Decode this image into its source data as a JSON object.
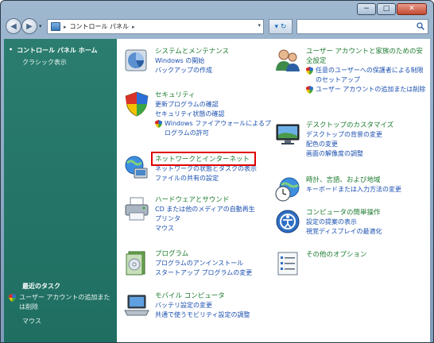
{
  "window": {
    "caption_minimize": "−",
    "caption_maximize": "□",
    "caption_close": "✕"
  },
  "nav": {
    "back_glyph": "◀",
    "forward_glyph": "▶",
    "recent_glyph": "▾",
    "address_segments": [
      "コントロール パネル"
    ],
    "address_separator": "▸",
    "address_dropdown": "▾",
    "refresh_glyph": "▾ ↻",
    "search_placeholder": ""
  },
  "sidebar": {
    "home_bullet": "•",
    "home_label": "コントロール パネル ホーム",
    "classic_label": "クラシック表示",
    "recent_tasks_heading": "最近のタスク",
    "recent_tasks": [
      "ユーザー アカウントの追加または削除",
      "マウス"
    ]
  },
  "left_categories": [
    {
      "icon": "system-pie-icon",
      "title": "システムとメンテナンス",
      "links": [
        "Windows の開始",
        "バックアップの作成"
      ]
    },
    {
      "icon": "security-shield-icon",
      "title": "セキュリティ",
      "links": [
        "更新プログラムの確認",
        "セキュリティ状態の確認"
      ],
      "shield_link": "Windows ファイアウォールによるプログラムの許可"
    },
    {
      "icon": "network-globe-icon",
      "title": "ネットワークとインターネット",
      "links": [
        "ネットワークの状態とタスクの表示",
        "ファイルの共有の設定"
      ]
    },
    {
      "icon": "hardware-printer-icon",
      "title": "ハードウェアとサウンド",
      "links": [
        "CD または他のメディアの自動再生",
        "プリンタ",
        "マウス"
      ]
    },
    {
      "icon": "programs-icon",
      "title": "プログラム",
      "links": [
        "プログラムのアンインストール",
        "スタートアップ プログラムの変更"
      ]
    },
    {
      "icon": "mobile-laptop-icon",
      "title": "モバイル コンピュータ",
      "links": [
        "バッテリ設定の変更",
        "共通で使うモビリティ設定の調整"
      ]
    }
  ],
  "right_categories": [
    {
      "icon": "users-icon",
      "title": "ユーザー アカウントと家族のための安全設定",
      "shield_links": [
        "任意のユーザーへの保護者による制限のセットアップ",
        "ユーザー アカウントの追加または削除"
      ]
    },
    {
      "icon": "desktop-icon",
      "title": "デスクトップのカスタマイズ",
      "links": [
        "デスクトップの背景の変更",
        "配色の変更",
        "画面の解像度の調整"
      ]
    },
    {
      "icon": "clock-globe-icon",
      "title": "時計、言語、および地域",
      "links": [
        "キーボードまたは入力方法の変更"
      ]
    },
    {
      "icon": "ease-of-access-icon",
      "title": "コンピュータの簡単操作",
      "links": [
        "設定の提案の表示",
        "視覚ディスプレイの最適化"
      ]
    },
    {
      "icon": "other-options-icon",
      "title": "その他のオプション",
      "links": []
    }
  ],
  "colors": {
    "sidebar": "#1f6e61",
    "category_title": "#1c7b2f",
    "link": "#1a4fb0",
    "highlight_box": "#e00000"
  }
}
